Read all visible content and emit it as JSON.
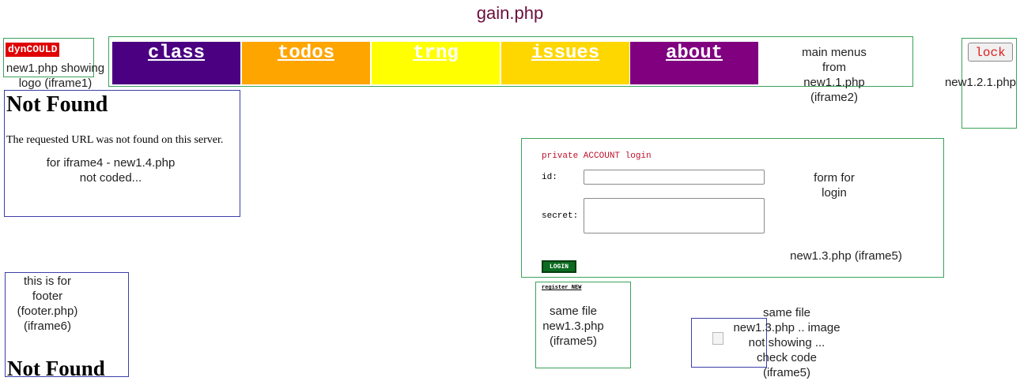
{
  "page": {
    "title": "gain.php"
  },
  "logo": {
    "badge": "dynCOULD",
    "note_line1": "new1.php showing",
    "note_line2": "logo (iframe1)"
  },
  "menu": {
    "items": [
      {
        "label": "class",
        "color": "#4b0082"
      },
      {
        "label": "todos",
        "color": "#ffa500"
      },
      {
        "label": "trng",
        "color": "#ffff00"
      },
      {
        "label": "issues",
        "color": "#ffd700"
      },
      {
        "label": "about",
        "color": "#800080"
      }
    ],
    "note_lines": [
      "main menus",
      "from",
      "new1.1.php",
      "(iframe2)"
    ]
  },
  "lock": {
    "button_label": "lock",
    "note": "new1.2.1.php"
  },
  "notfound_top": {
    "heading": "Not Found",
    "message": "The requested URL was not found on this server.",
    "note_line1": "for iframe4 - new1.4.php",
    "note_line2": "not coded..."
  },
  "login": {
    "title": "private ACCOUNT login",
    "id_label": "id:",
    "id_value": "",
    "secret_label": "secret:",
    "secret_value": "",
    "button_label": "LOGIN",
    "note_line1": "form for",
    "note_line2": "login",
    "file_note": "new1.3.php (iframe5)"
  },
  "footer": {
    "note_lines": [
      "this is for",
      "footer",
      "(footer.php)",
      "(iframe6)"
    ],
    "heading": "Not Found"
  },
  "register": {
    "link_label": "register NEW",
    "note_lines": [
      "same file",
      "new1.3.php",
      "(iframe5)"
    ]
  },
  "image_frame": {
    "note_lines": [
      "same file",
      "new1.3.php .. image",
      "not showing ...",
      "check code",
      "(iframe5)"
    ]
  },
  "colors": {
    "title": "#6b0f3b",
    "frame_green": "#3aa35a",
    "frame_blue": "#3b3fa8",
    "logo_badge": "#e00000",
    "login_title": "#c0102a",
    "login_button": "#0c6b20"
  }
}
